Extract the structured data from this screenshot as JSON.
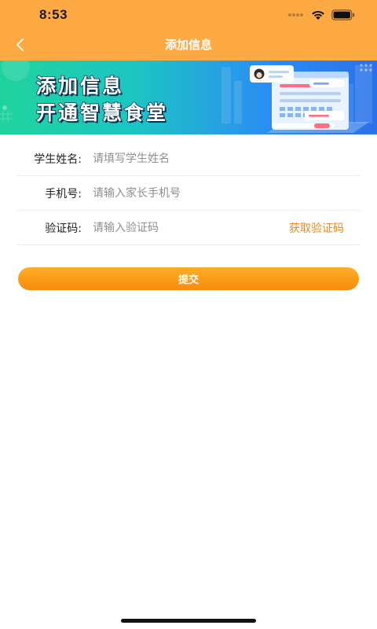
{
  "status_bar": {
    "time": "8:53"
  },
  "nav": {
    "title": "添加信息",
    "back_icon": "chevron-left-icon"
  },
  "banner": {
    "line1": "添加信息",
    "line2": "开通智慧食堂"
  },
  "form": {
    "student_name": {
      "label": "学生姓名:",
      "placeholder": "请填写学生姓名",
      "value": ""
    },
    "phone": {
      "label": "手机号:",
      "placeholder": "请输入家长手机号",
      "value": ""
    },
    "code": {
      "label": "验证码:",
      "placeholder": "请输入验证码",
      "value": "",
      "get_code_label": "获取验证码"
    }
  },
  "submit": {
    "label": "提交"
  },
  "colors": {
    "header_bg": "#FDAA45",
    "accent": "#F28A1E",
    "button_top": "#FDAE28",
    "button_bottom": "#F98B0A"
  }
}
